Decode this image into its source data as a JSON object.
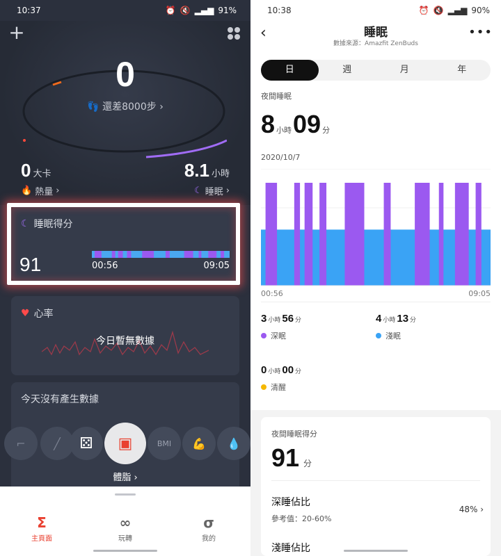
{
  "left": {
    "status": {
      "time": "10:37",
      "battery": "91%"
    },
    "steps": {
      "value": "0",
      "remaining": "還差8000步"
    },
    "calories": {
      "value": "0",
      "unit": "大卡",
      "label": "熱量"
    },
    "sleep": {
      "value": "8.1",
      "unit": "小時",
      "label": "睡眠"
    },
    "sleep_score_card": {
      "title": "睡眠得分",
      "score": "91",
      "start": "00:56",
      "end": "09:05"
    },
    "heart_card": {
      "title": "心率",
      "no_data": "今日暫無數據"
    },
    "body_card": {
      "title": "今天沒有產生數據",
      "selected": "體脂",
      "icons": [
        "BMI"
      ]
    },
    "tabs": [
      {
        "label": "主頁面",
        "icon": "Σ"
      },
      {
        "label": "玩轉",
        "icon": "∞"
      },
      {
        "label": "我的",
        "icon": "σ"
      }
    ]
  },
  "right": {
    "status": {
      "time": "10:38",
      "battery": "90%"
    },
    "title": "睡眠",
    "source": "數據來源：Amazfit ZenBuds",
    "periods": [
      "日",
      "週",
      "月",
      "年"
    ],
    "night_label": "夜間睡眠",
    "duration": {
      "hours": "8",
      "hours_unit": "小時",
      "minutes": "09",
      "minutes_unit": "分"
    },
    "date": "2020/10/7",
    "axis_start": "00:56",
    "axis_end": "09:05",
    "stages": [
      {
        "h": "3",
        "m": "56",
        "label": "深眠",
        "color": "#9b59f0"
      },
      {
        "h": "4",
        "m": "13",
        "label": "淺眠",
        "color": "#3aa3f5"
      },
      {
        "h": "0",
        "m": "00",
        "label": "清醒",
        "color": "#f5b800"
      }
    ],
    "units": {
      "hour": "小時",
      "minute": "分"
    },
    "score": {
      "label": "夜間睡眠得分",
      "value": "91",
      "unit": "分"
    },
    "deep_ratio": {
      "title": "深睡佔比",
      "ref": "參考值：20-60%",
      "value": "48%"
    },
    "next_row": "淺睡佔比"
  },
  "colors": {
    "deep": "#9b59f0",
    "light": "#3aa3f5",
    "awake": "#f5b800",
    "accent": "#e94030"
  },
  "chart_data": {
    "type": "timeline",
    "x_start": "00:56",
    "x_end": "09:05",
    "deep_segments": [
      [
        0.02,
        0.07
      ],
      [
        0.145,
        0.17
      ],
      [
        0.19,
        0.225
      ],
      [
        0.255,
        0.285
      ],
      [
        0.365,
        0.45
      ],
      [
        0.535,
        0.565
      ],
      [
        0.67,
        0.735
      ],
      [
        0.775,
        0.795
      ],
      [
        0.845,
        0.905
      ],
      [
        0.935,
        0.96
      ]
    ],
    "light_level": 0.48
  }
}
